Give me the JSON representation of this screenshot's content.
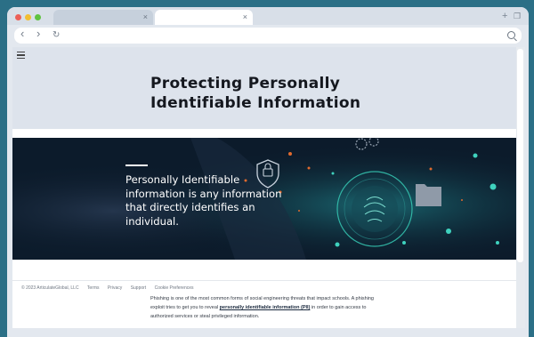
{
  "browser": {
    "tab_close_glyph": "×",
    "new_tab_glyph": "+",
    "restore_glyph": "❐",
    "back_glyph": "‹",
    "forward_glyph": "›",
    "reload_glyph": "↻"
  },
  "page": {
    "title_line1": "Protecting Personally",
    "title_line2": "Identifiable Information",
    "banner_text": "Personally Identifiable information is any information that directly identifies an individual.",
    "body_before": "Phishing is one of the most common forms of social engineering threats that impact schools. A phishing exploit tries to get you to reveal ",
    "body_link": "personally identifiable information (PII)",
    "body_after": " in order to gain access to authorized services or steal privileged information."
  },
  "footer": {
    "copyright": "© 2023 ArticulateGlobal, LLC",
    "links": [
      "Terms",
      "Privacy",
      "Support",
      "Cookie Preferences"
    ]
  },
  "colors": {
    "desktop": "#2b6f86",
    "banner": "#0c1b2b",
    "accent": "#34c9b6"
  }
}
